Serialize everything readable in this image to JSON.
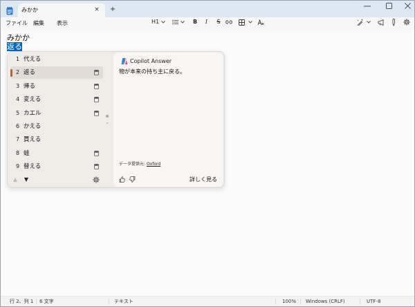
{
  "window": {
    "tab_title": "みかか",
    "tab_close": "×",
    "new_tab": "+"
  },
  "menu": {
    "file": "ファイル",
    "edit": "編集",
    "view": "表示"
  },
  "toolbar": {
    "heading": "H1",
    "bold": "B",
    "italic": "I",
    "strikethrough": "S"
  },
  "editor": {
    "line1": "みかか",
    "line2_selected": "返る"
  },
  "ime": {
    "selected_index": 1,
    "candidates": [
      {
        "num": "1",
        "text": "代える",
        "has_detail": false
      },
      {
        "num": "2",
        "text": "返る",
        "has_detail": true
      },
      {
        "num": "3",
        "text": "帰る",
        "has_detail": true
      },
      {
        "num": "4",
        "text": "変える",
        "has_detail": true
      },
      {
        "num": "5",
        "text": "カエル",
        "has_detail": true
      },
      {
        "num": "6",
        "text": "かえる",
        "has_detail": false
      },
      {
        "num": "7",
        "text": "買える",
        "has_detail": false
      },
      {
        "num": "8",
        "text": "蛙",
        "has_detail": true
      },
      {
        "num": "9",
        "text": "替える",
        "has_detail": true
      }
    ],
    "page_up": "▲",
    "page_down": "▼",
    "answer": {
      "brand": "Copilot Answer",
      "definition": "物が本来の持ち主に戻る。",
      "source_label": "データ提供元: ",
      "source_link": "Oxford",
      "more": "詳しく見る"
    }
  },
  "status": {
    "position": "行 2、列 1",
    "characters": "6 文字",
    "format": "テキスト",
    "zoom": "100%",
    "line_ending": "Windows (CRLF)",
    "encoding": "UTF-8"
  },
  "icons": {
    "app": "notepad-icon",
    "window_controls": [
      "minimize-icon",
      "maximize-icon",
      "close-icon"
    ],
    "toolbar": [
      "chevron-down-icon",
      "list-icon",
      "link-icon",
      "table-icon",
      "clear-format-icon",
      "rewrite-icon",
      "megaphone-icon",
      "pen-icon",
      "gear-icon"
    ],
    "candidate": [
      "detail-card-icon",
      "gear-icon"
    ],
    "answer": [
      "copilot-logo",
      "thumbs-up-icon",
      "thumbs-down-icon"
    ]
  },
  "colors": {
    "selection": "#0067c0",
    "candidate_accent": "#b45f2d",
    "title_bar": "#dde7f1"
  }
}
